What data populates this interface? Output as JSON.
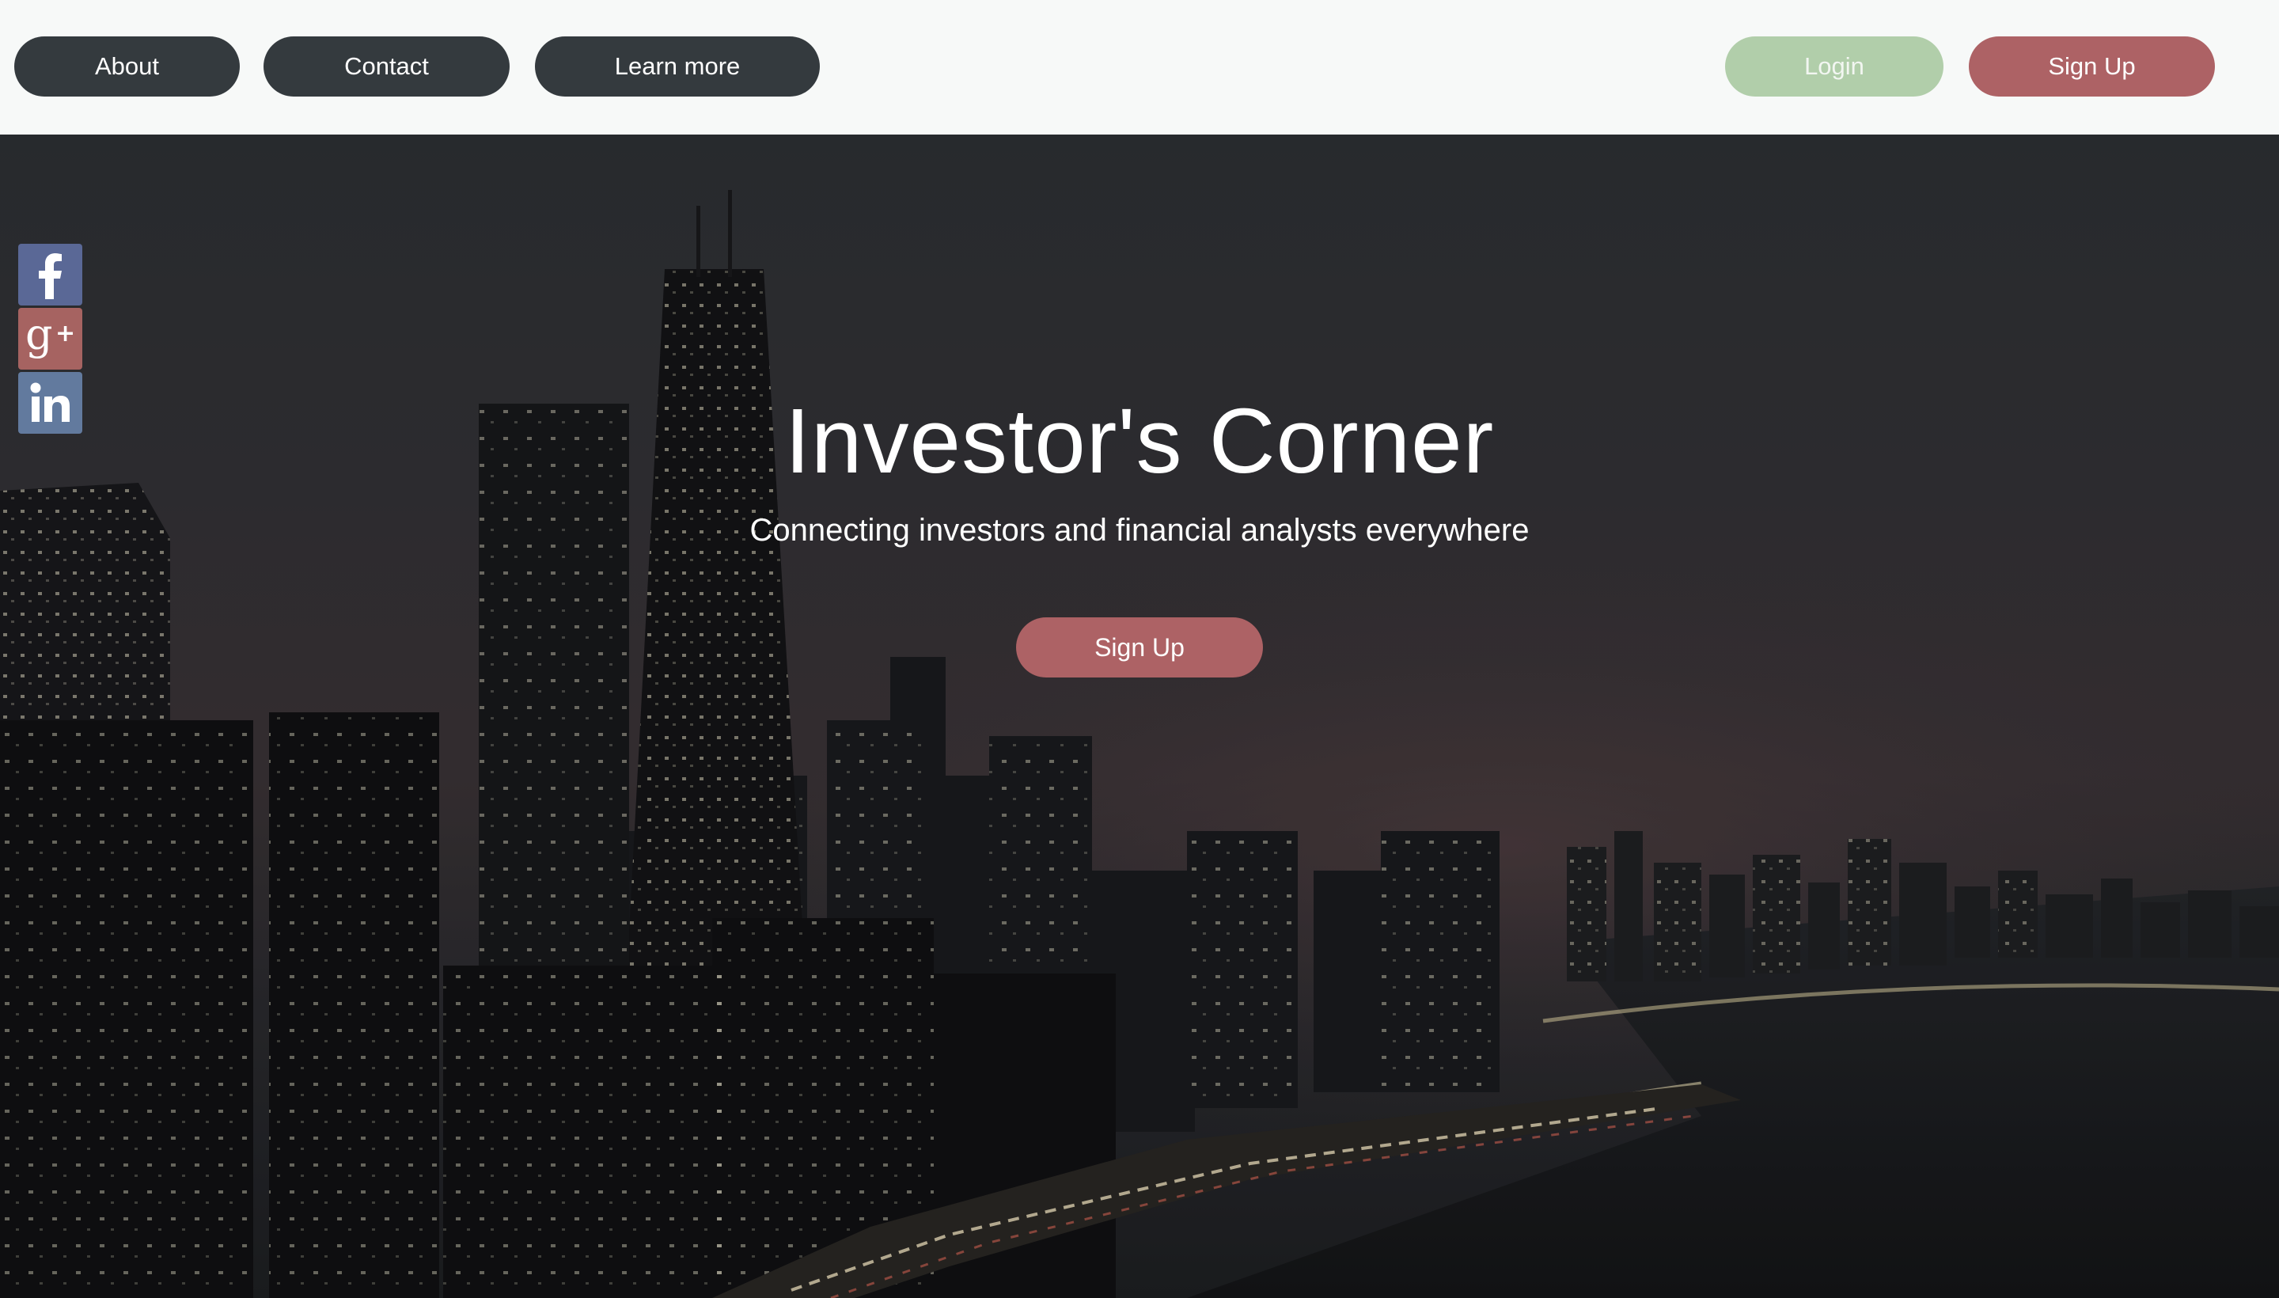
{
  "nav": {
    "about_label": "About",
    "contact_label": "Contact",
    "learn_more_label": "Learn more",
    "login_label": "Login",
    "signup_label": "Sign Up"
  },
  "hero": {
    "title": "Investor's Corner",
    "subtitle": "Connecting investors and financial analysts everywhere",
    "cta_label": "Sign Up"
  },
  "social": [
    {
      "name": "facebook",
      "icon": "facebook-icon",
      "color": "#5a6896"
    },
    {
      "name": "google-plus",
      "icon": "google-plus-icon",
      "color": "#a66361"
    },
    {
      "name": "linkedin",
      "icon": "linkedin-icon",
      "color": "#627a9e"
    }
  ],
  "colors": {
    "nav_dark": "#343a3e",
    "login_green": "#b1ceaa",
    "signup_rose": "#ad6265",
    "topbar_bg": "#f7f9f8"
  }
}
